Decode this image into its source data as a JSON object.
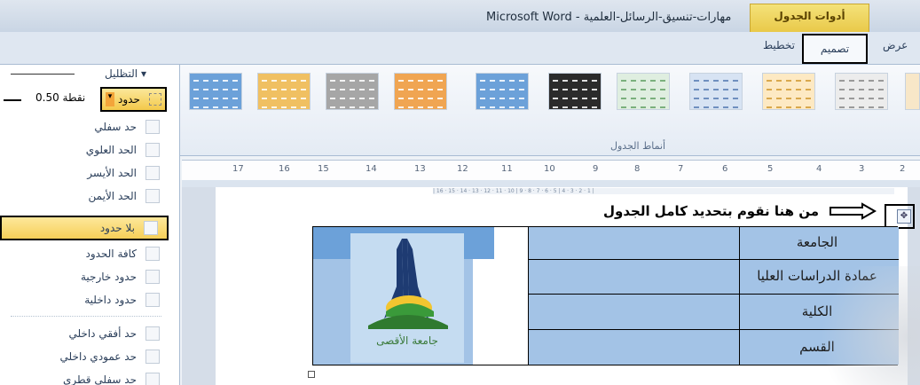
{
  "title": {
    "app": "Microsoft Word",
    "document": "مهارات-تنسيق-الرسائل-العلمية"
  },
  "context_group": "أدوات الجدول",
  "tabs": [
    {
      "label": "عرض"
    },
    {
      "label": "تصميم"
    },
    {
      "label": "تخطيط"
    }
  ],
  "ribbon": {
    "group_label": "أنماط الجدول",
    "pen_color_label": "التظليل ▾",
    "pen_weight": "0.50 نقطة",
    "borders_button": "حدود"
  },
  "menu": [
    {
      "label": "حد سفلي"
    },
    {
      "label": "الحد العلوي"
    },
    {
      "label": "الحد الأيسر"
    },
    {
      "label": "الحد الأيمن"
    },
    {
      "label": "بلا حدود",
      "highlighted": true
    },
    {
      "label": "كافة الحدود"
    },
    {
      "label": "حدود خارجية"
    },
    {
      "label": "حدود داخلية"
    },
    {
      "label": "حد أفقي داخلي"
    },
    {
      "label": "حد عمودي داخلي"
    },
    {
      "label": "حد سفلي قطري"
    }
  ],
  "ruler": [
    "17",
    "16",
    "15",
    "14",
    "13",
    "12",
    "11",
    "10",
    "9",
    "8",
    "7",
    "6",
    "5",
    "4",
    "3",
    "2",
    "1"
  ],
  "document": {
    "note": "من هنا نقوم بتحديد كامل الجدول",
    "move_handle": "✥",
    "table_rows": [
      {
        "label": "الجامعة"
      },
      {
        "label": "عمادة الدراسات العليا"
      },
      {
        "label": "الكلية"
      },
      {
        "label": "القسم"
      }
    ],
    "logo_text": "جامعة الأقصى"
  },
  "colors": {
    "style_blue": "#6ca1d9",
    "style_orange": "#f0a552",
    "style_dark": "#2b2b2b",
    "highlight": "#f6cf58"
  }
}
